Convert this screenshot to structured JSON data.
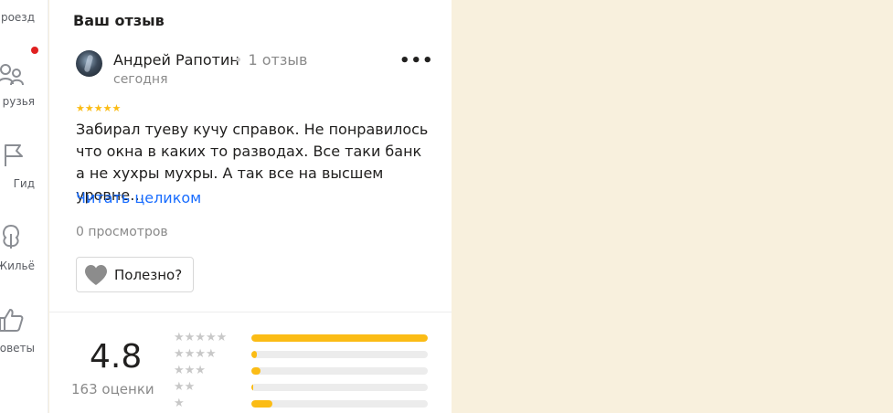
{
  "rail": {
    "items": [
      {
        "label": "роезд",
        "icon": "route-icon"
      },
      {
        "label": "рузья",
        "icon": "friends-icon"
      },
      {
        "label": "Гид",
        "icon": "flag-icon"
      },
      {
        "label": "Жильё",
        "icon": "housing-icon"
      },
      {
        "label": "оветы",
        "icon": "thumbs-up-icon"
      }
    ],
    "notification_color": "#e02020"
  },
  "review": {
    "section_title": "Ваш отзыв",
    "author": "Андрей Рапотин",
    "author_reviews": "1 отзыв",
    "date": "сегодня",
    "rating_stars": "★★★★★",
    "text": "Забирал туеву кучу справок. Не понравилось что окна в каких то разводах. Все таки банк а не хухры мухры. А так все на высшем уровне…",
    "read_more": "Читать целиком",
    "views": "0 просмотров",
    "useful_label": "Полезно?",
    "more_icon": "more-dots-icon"
  },
  "summary": {
    "rating": "4.8",
    "count_label": "163 оценки",
    "distribution": [
      {
        "stars": "★★★★★",
        "fraction": 1.0
      },
      {
        "stars": "★★★★",
        "fraction": 0.03
      },
      {
        "stars": "★★★",
        "fraction": 0.05
      },
      {
        "stars": "★★",
        "fraction": 0.01
      },
      {
        "stars": "★",
        "fraction": 0.12
      }
    ],
    "bar_color": "#fbbc15"
  }
}
